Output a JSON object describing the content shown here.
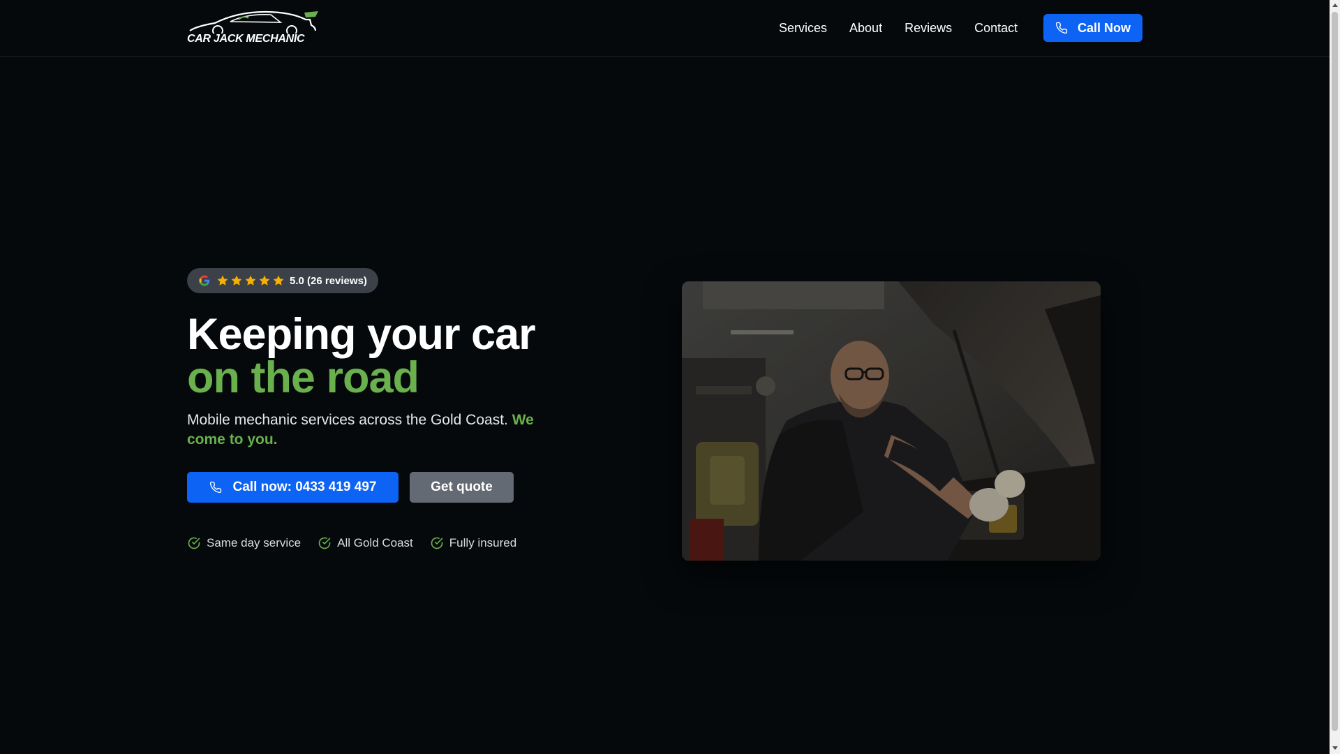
{
  "header": {
    "logo_text": "CAR JACK MECHANIC",
    "nav": [
      "Services",
      "About",
      "Reviews",
      "Contact"
    ],
    "call_label": "Call Now"
  },
  "hero": {
    "rating": {
      "stars": 5,
      "text": "5.0 (26 reviews)"
    },
    "headline_line1": "Keeping your car",
    "headline_line2": "on the road",
    "subtitle_plain": "Mobile mechanic services across the Gold Coast.",
    "subtitle_highlight": "We come to you.",
    "primary_button": "Call now: 0433 419 497",
    "secondary_button": "Get quote",
    "features": [
      "Same day service",
      "All Gold Coast",
      "Fully insured"
    ]
  },
  "colors": {
    "background": "#05090c",
    "accent_green": "#6ab04c",
    "primary_blue": "#0d63f3",
    "star_yellow": "#f6b100",
    "pill_gray": "#3c4149",
    "secondary_gray": "#646a73"
  },
  "icons": {
    "phone": "phone-icon",
    "check": "check-circle-icon",
    "star": "star-icon",
    "google": "google-icon"
  }
}
